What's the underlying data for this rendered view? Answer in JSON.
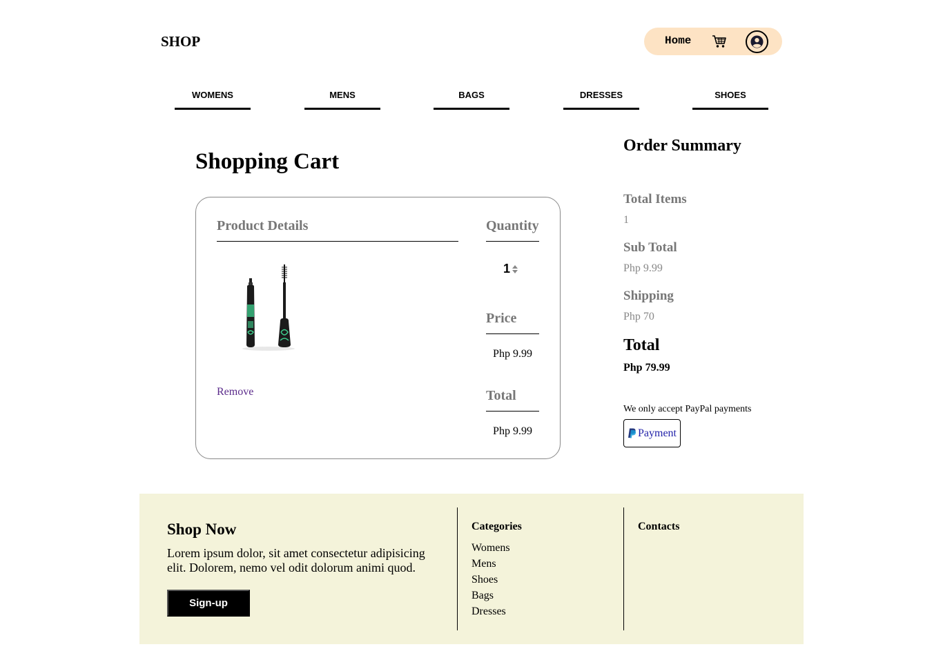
{
  "header": {
    "brand": "SHOP",
    "home_label": "Home",
    "cart_icon": "shopping-cart-icon",
    "user_icon": "user-circle-icon",
    "accent_color": "#fde3c4"
  },
  "nav": {
    "items": [
      "WOMENS",
      "MENS",
      "BAGS",
      "DRESSES",
      "SHOES"
    ]
  },
  "cart": {
    "title": "Shopping Cart",
    "product_details_label": "Product Details",
    "quantity_label": "Quantity",
    "price_label": "Price",
    "total_label": "Total",
    "item": {
      "quantity": "1",
      "price": "Php 9.99",
      "total": "Php 9.99",
      "remove_label": "Remove"
    }
  },
  "summary": {
    "title": "Order Summary",
    "total_items_label": "Total Items",
    "total_items_value": "1",
    "subtotal_label": "Sub Total",
    "subtotal_value": "Php 9.99",
    "shipping_label": "Shipping",
    "shipping_value": "Php 70",
    "total_label": "Total",
    "total_value": "Php 79.99",
    "payment_note": "We only accept PayPal payments",
    "payment_button": "Payment",
    "payment_icon": "paypal-icon"
  },
  "footer": {
    "title": "Shop Now",
    "text": "Lorem ipsum dolor, sit amet consectetur adipisicing elit. Dolorem, nemo vel odit dolorum animi quod.",
    "signup_label": "Sign-up",
    "categories_heading": "Categories",
    "categories": [
      "Womens",
      "Mens",
      "Shoes",
      "Bags",
      "Dresses"
    ],
    "contacts_heading": "Contacts",
    "background_color": "#f4f3da"
  }
}
